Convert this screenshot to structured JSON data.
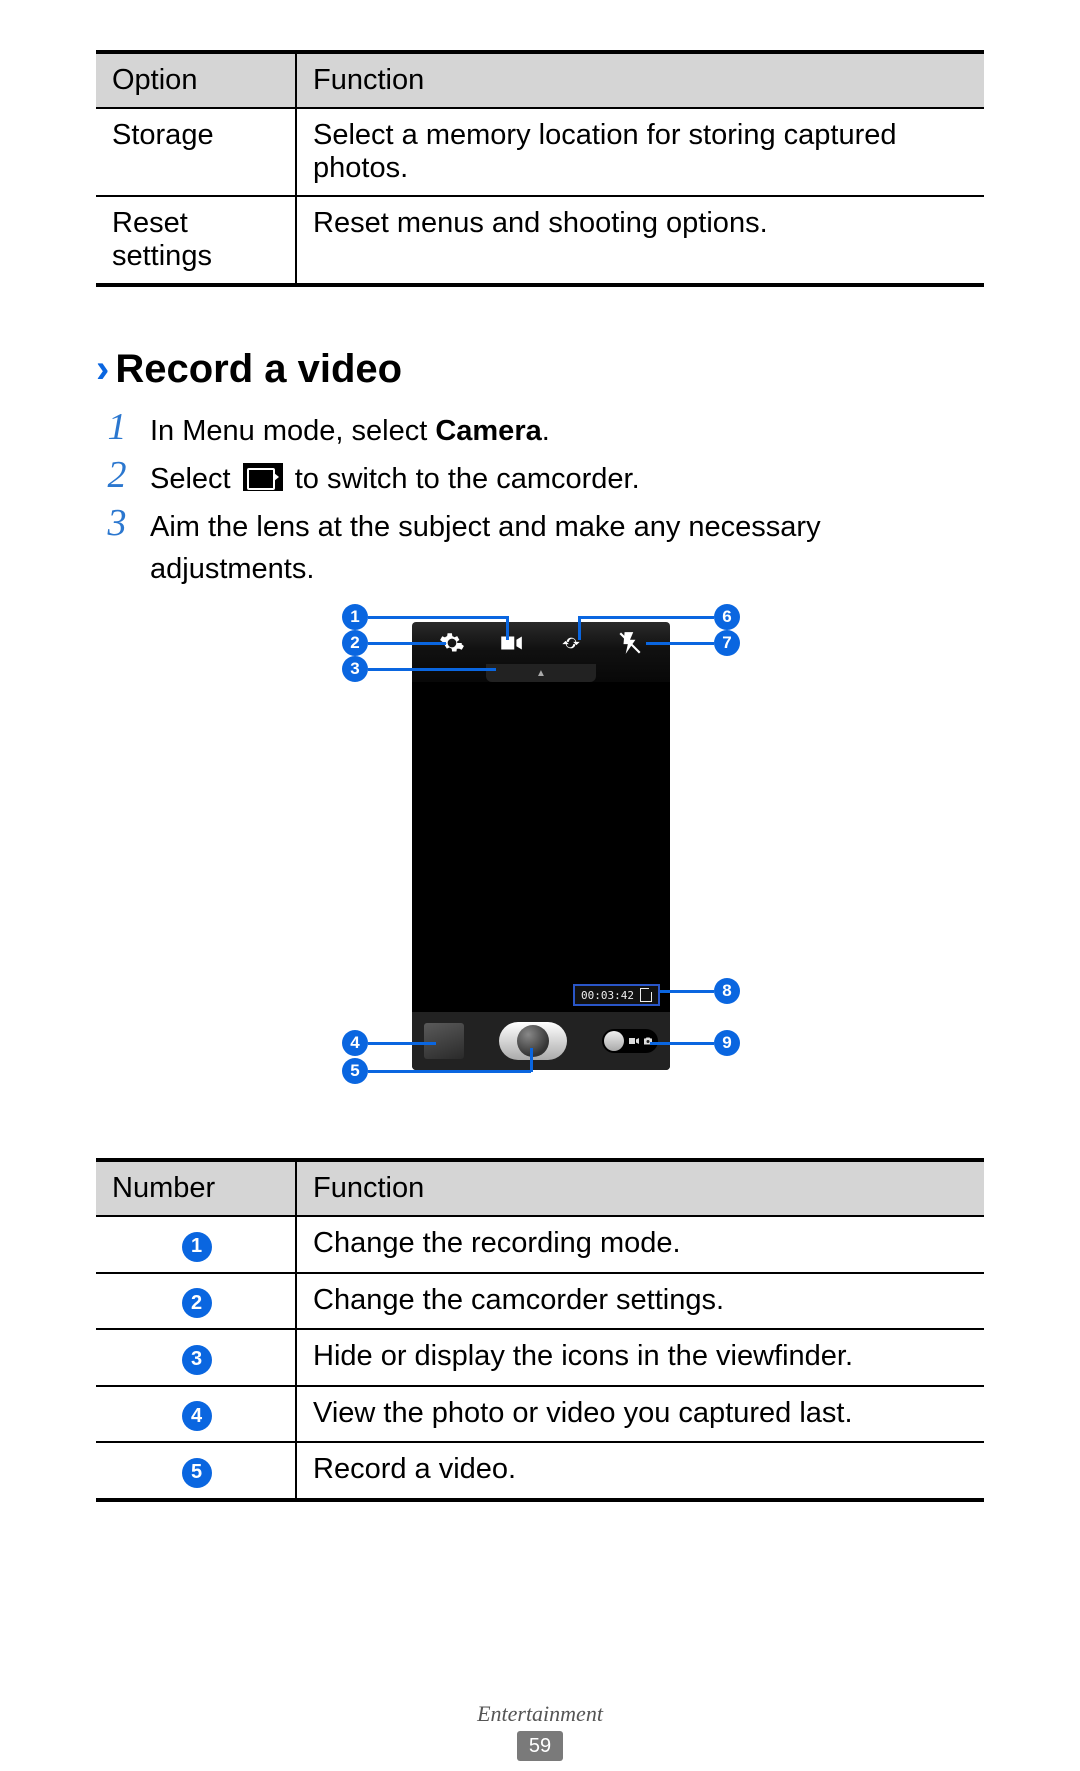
{
  "table1": {
    "headers": {
      "option": "Option",
      "func": "Function"
    },
    "rows": [
      {
        "option": "Storage",
        "func": "Select a memory location for storing captured photos."
      },
      {
        "option": "Reset settings",
        "func": "Reset menus and shooting options."
      }
    ]
  },
  "section": {
    "chevron": "›",
    "title": "Record a video"
  },
  "steps": {
    "s1_num": "1",
    "s1_pre": "In Menu mode, select ",
    "s1_bold": "Camera",
    "s1_post": ".",
    "s2_num": "2",
    "s2_pre": "Select ",
    "s2_post": " to switch to the camcorder.",
    "s3_num": "3",
    "s3_text": "Aim the lens at the subject and make any necessary adjustments."
  },
  "diagram": {
    "badges": {
      "b1": "1",
      "b2": "2",
      "b3": "3",
      "b4": "4",
      "b5": "5",
      "b6": "6",
      "b7": "7",
      "b8": "8",
      "b9": "9"
    },
    "timecode": "00:03:42",
    "hidebar": "▲"
  },
  "table2": {
    "headers": {
      "num": "Number",
      "func": "Function"
    },
    "rows": [
      {
        "n": "1",
        "func": "Change the recording mode."
      },
      {
        "n": "2",
        "func": "Change the camcorder settings."
      },
      {
        "n": "3",
        "func": "Hide or display the icons in the viewfinder."
      },
      {
        "n": "4",
        "func": "View the photo or video you captured last."
      },
      {
        "n": "5",
        "func": "Record a video."
      }
    ]
  },
  "footer": {
    "chapter": "Entertainment",
    "page": "59"
  }
}
